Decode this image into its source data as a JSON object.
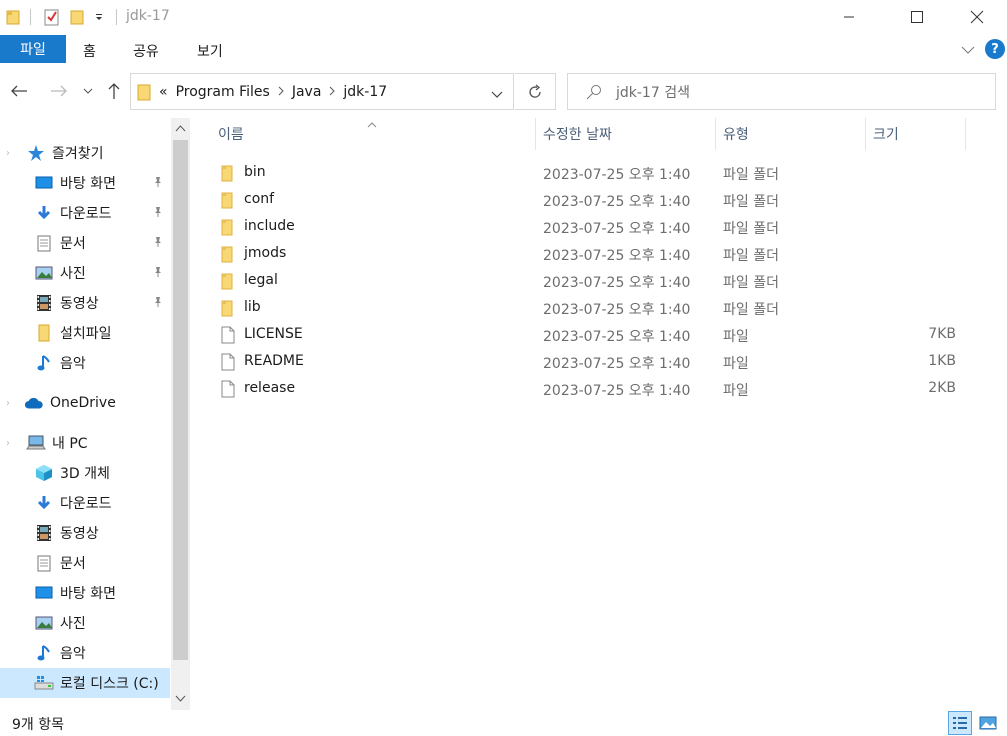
{
  "window": {
    "title": "jdk-17"
  },
  "ribbon": {
    "tabs": [
      "파일",
      "홈",
      "공유",
      "보기"
    ]
  },
  "address": {
    "overflow": "«",
    "breadcrumbs": [
      "Program Files",
      "Java",
      "jdk-17"
    ]
  },
  "search": {
    "placeholder": "jdk-17 검색"
  },
  "sidebar": {
    "quick_access": "즐겨찾기",
    "quick_items": [
      {
        "label": "바탕 화면",
        "icon": "desktop-icon",
        "pinned": true
      },
      {
        "label": "다운로드",
        "icon": "download-icon",
        "pinned": true
      },
      {
        "label": "문서",
        "icon": "document-icon",
        "pinned": true
      },
      {
        "label": "사진",
        "icon": "picture-icon",
        "pinned": true
      },
      {
        "label": "동영상",
        "icon": "video-icon",
        "pinned": true
      },
      {
        "label": "설치파일",
        "icon": "folder-icon",
        "pinned": false
      },
      {
        "label": "음악",
        "icon": "music-icon",
        "pinned": false
      }
    ],
    "onedrive": "OneDrive",
    "this_pc": "내 PC",
    "pc_items": [
      {
        "label": "3D 개체",
        "icon": "cube-3d-icon"
      },
      {
        "label": "다운로드",
        "icon": "download-icon"
      },
      {
        "label": "동영상",
        "icon": "video-icon"
      },
      {
        "label": "문서",
        "icon": "document-icon"
      },
      {
        "label": "바탕 화면",
        "icon": "desktop-icon"
      },
      {
        "label": "사진",
        "icon": "picture-icon"
      },
      {
        "label": "음악",
        "icon": "music-icon"
      },
      {
        "label": "로컬 디스크 (C:)",
        "icon": "drive-icon"
      }
    ]
  },
  "columns": {
    "name": "이름",
    "date": "수정한 날짜",
    "type": "유형",
    "size": "크기"
  },
  "files": [
    {
      "name": "bin",
      "date": "2023-07-25 오후 1:40",
      "type": "파일 폴더",
      "size": "",
      "kind": "folder"
    },
    {
      "name": "conf",
      "date": "2023-07-25 오후 1:40",
      "type": "파일 폴더",
      "size": "",
      "kind": "folder"
    },
    {
      "name": "include",
      "date": "2023-07-25 오후 1:40",
      "type": "파일 폴더",
      "size": "",
      "kind": "folder"
    },
    {
      "name": "jmods",
      "date": "2023-07-25 오후 1:40",
      "type": "파일 폴더",
      "size": "",
      "kind": "folder"
    },
    {
      "name": "legal",
      "date": "2023-07-25 오후 1:40",
      "type": "파일 폴더",
      "size": "",
      "kind": "folder"
    },
    {
      "name": "lib",
      "date": "2023-07-25 오후 1:40",
      "type": "파일 폴더",
      "size": "",
      "kind": "folder"
    },
    {
      "name": "LICENSE",
      "date": "2023-07-25 오후 1:40",
      "type": "파일",
      "size": "7KB",
      "kind": "file"
    },
    {
      "name": "README",
      "date": "2023-07-25 오후 1:40",
      "type": "파일",
      "size": "1KB",
      "kind": "file"
    },
    {
      "name": "release",
      "date": "2023-07-25 오후 1:40",
      "type": "파일",
      "size": "2KB",
      "kind": "file"
    }
  ],
  "status": {
    "count": "9개 항목"
  },
  "colors": {
    "accent": "#1979ca",
    "folder": "#f8d775",
    "selection": "#cce8ff"
  }
}
